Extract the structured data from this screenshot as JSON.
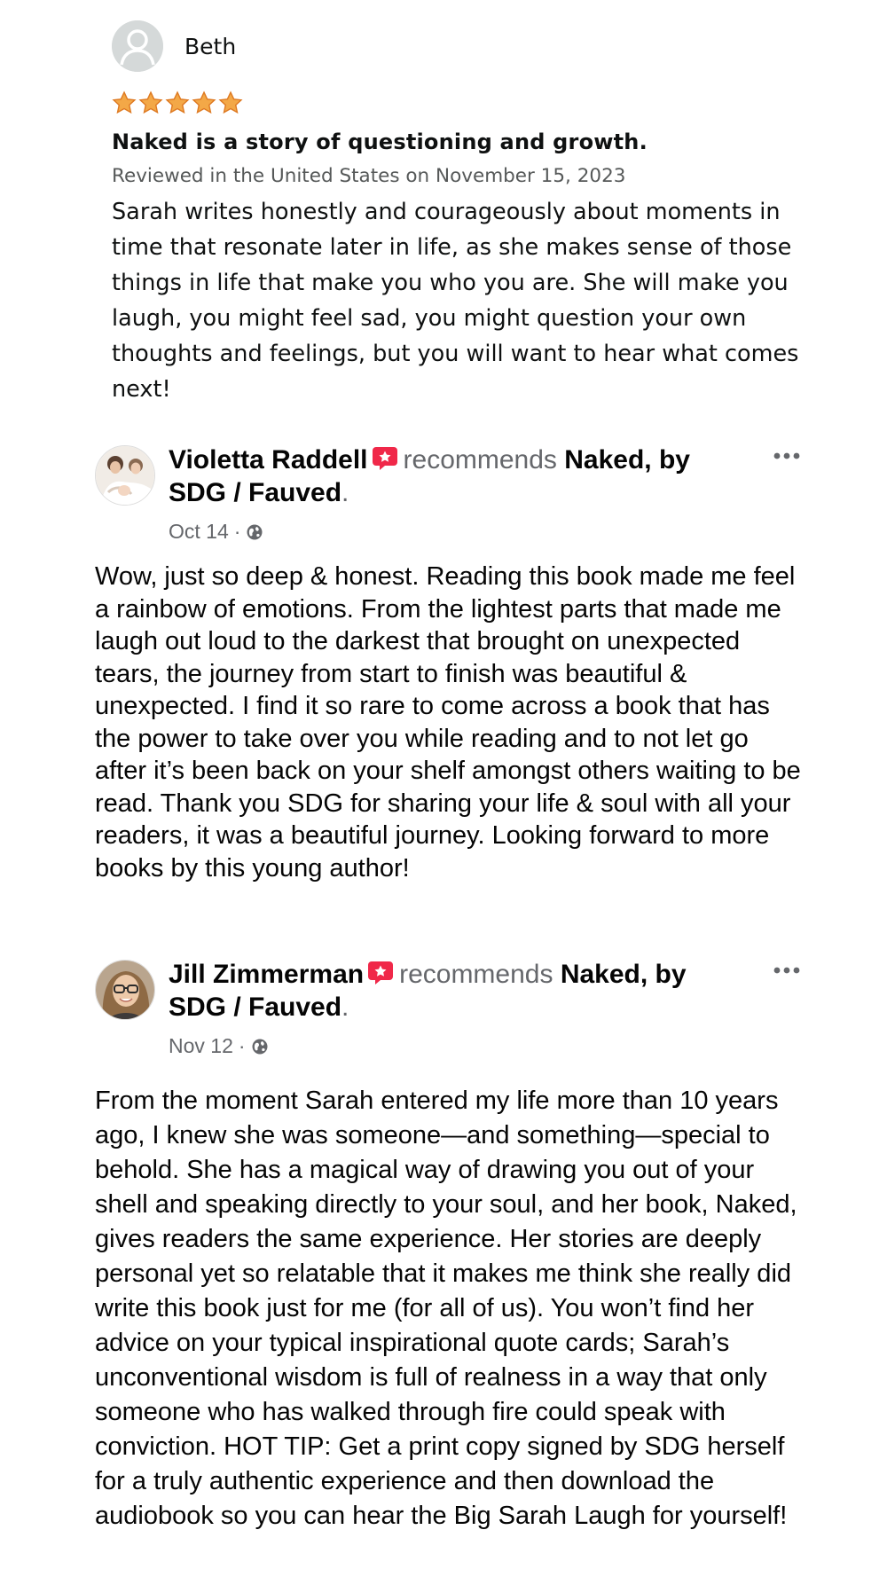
{
  "amazon_review": {
    "reviewer_name": "Beth",
    "avatar_icon": "default-user-avatar-icon",
    "rating": 5,
    "rating_max": 5,
    "star_color": "#f3a847",
    "title": "Naked is a story of questioning and growth.",
    "meta": "Reviewed in the United States on November 15, 2023",
    "body": "Sarah writes honestly and courageously about moments in time that resonate later in life, as she makes sense of those things in life that make you who you are. She will make you laugh, you might feel sad, you might question your own thoughts and feelings, but you will want to hear what comes next!"
  },
  "facebook_posts": [
    {
      "author": "Violetta Raddell",
      "badge_icon": "recommendation-flag-icon",
      "badge_color": "#f02849",
      "recommends_text": "recommends",
      "page": "Naked, by SDG / Fauved",
      "period": ".",
      "date": "Oct 14",
      "separator": "·",
      "audience_icon": "globe-icon",
      "more_icon": "more-options-icon",
      "body": "Wow, just so deep & honest. Reading this book made me feel a rainbow of emotions. From the lightest parts that made me laugh out loud to the darkest that brought on unexpected tears, the journey from start to finish was beautiful & unexpected. I find it so rare to come across a book that has the power to take over you while reading and to not let go after it’s been back on your shelf amongst others waiting to be read. Thank you SDG for sharing your life & soul with all your readers, it was a beautiful journey. Looking forward to more books by this young author!"
    },
    {
      "author": "Jill Zimmerman",
      "badge_icon": "recommendation-flag-icon",
      "badge_color": "#f02849",
      "recommends_text": "recommends",
      "page": "Naked, by SDG / Fauved",
      "period": ".",
      "date": "Nov 12",
      "separator": "·",
      "audience_icon": "globe-icon",
      "more_icon": "more-options-icon",
      "body": "From the moment Sarah entered my life more than 10 years ago, I knew she was someone—and something—special to behold. She has a magical way of drawing you out of your shell and speaking directly to your soul, and her book, Naked, gives readers the same experience. Her stories are deeply personal yet so relatable that it makes me think she really did write this book just for me (for all of us). You won’t find her advice on your typical inspirational quote cards; Sarah’s unconventional wisdom is full of realness in a way that only someone who has walked through fire could speak with conviction. HOT TIP: Get a print copy signed by SDG herself for a truly authentic experience and then download the audiobook so you can hear the Big Sarah Laugh for yourself!"
    }
  ]
}
